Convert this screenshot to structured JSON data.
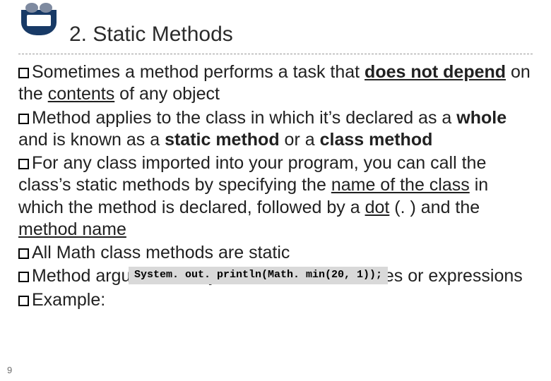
{
  "page_number": "9",
  "title": "2. Static Methods",
  "bullets": {
    "b1": {
      "pre": "Sometimes a method performs a task that ",
      "u1": "does not depend",
      "mid": " on the ",
      "u2": "contents",
      "post": " of any object"
    },
    "b2": {
      "pre": "Method applies to the class in which it’s declared as a ",
      "bold1": "whole",
      "mid": " and is known as a ",
      "bold2": "static method",
      "mid2": " or a ",
      "bold3": "class method"
    },
    "b3": {
      "pre": "For any class imported into your program, you can call the class’s static methods by specifying the ",
      "u1": "name of the class",
      "mid": " in which the method is declared, followed by a ",
      "u2": "dot",
      "paren": " (. )",
      "mid2": " and the ",
      "u3": "method name"
    },
    "b4": {
      "text": "All Math class methods are static"
    },
    "b5": {
      "text": "Method arguments may be constants, variables or expressions"
    },
    "b6": {
      "text": "Example:"
    }
  },
  "code": "System. out. println(Math. min(20, 1));"
}
